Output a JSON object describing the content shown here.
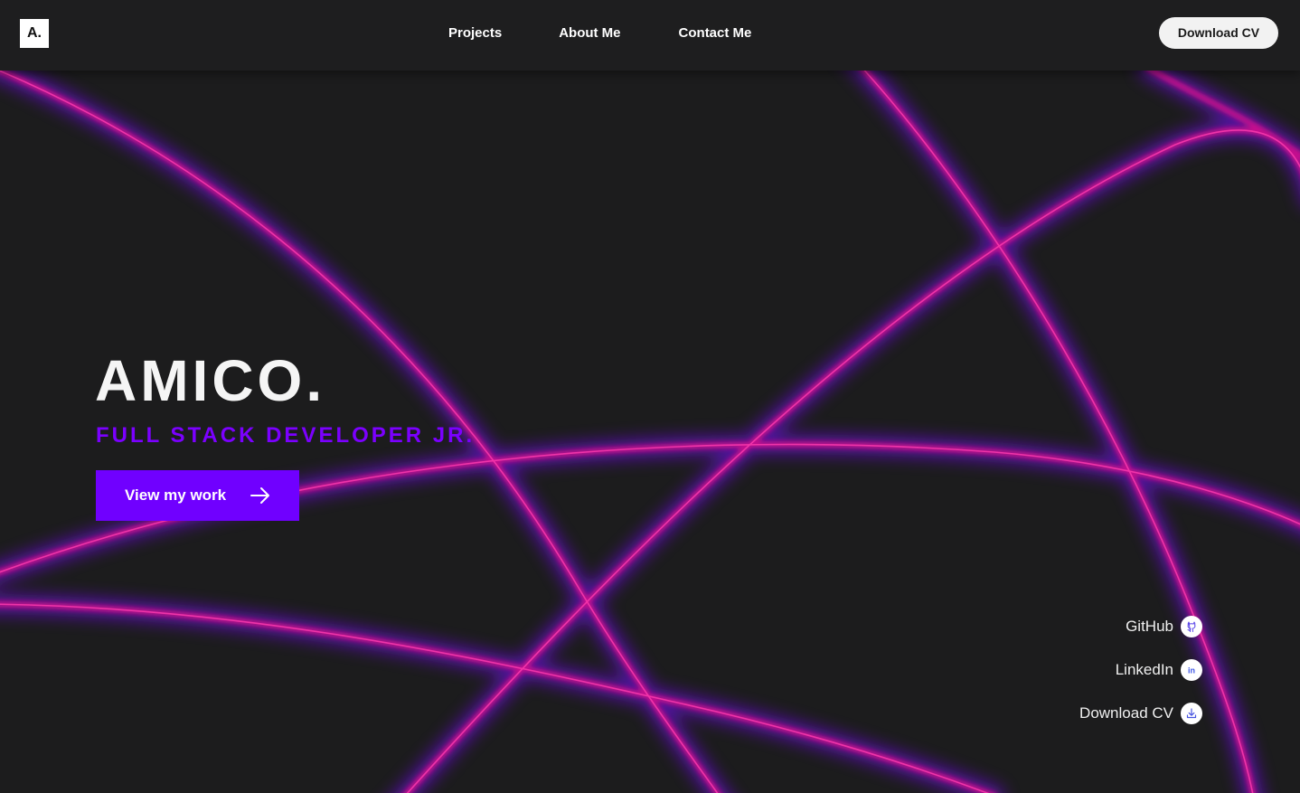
{
  "logo": {
    "text": "A."
  },
  "nav": {
    "links": [
      {
        "label": "Projects"
      },
      {
        "label": "About Me"
      },
      {
        "label": "Contact Me"
      }
    ],
    "cv_button": "Download CV"
  },
  "hero": {
    "title": "AMICO.",
    "subtitle": "FULL STACK DEVELOPER JR.",
    "cta_label": "View my work",
    "cta_icon": "arrow-right-icon"
  },
  "social": [
    {
      "label": "GitHub",
      "icon": "github-icon"
    },
    {
      "label": "LinkedIn",
      "icon": "linkedin-icon"
    },
    {
      "label": "Download CV",
      "icon": "download-icon"
    }
  ],
  "colors": {
    "background": "#1c1c1d",
    "accent": "#7000ff",
    "glow_pink": "#e0189a",
    "glow_violet": "#7a10ff"
  }
}
